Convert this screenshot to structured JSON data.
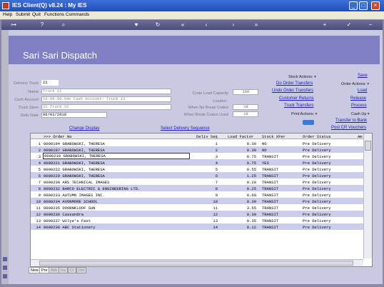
{
  "window": {
    "title": "IES Client(Q) v8.24 : My IES"
  },
  "menu": [
    "Help",
    "Submit",
    "Quit",
    "Functions",
    "Commands"
  ],
  "page": {
    "title": "Sari Sari Dispatch"
  },
  "form": {
    "delivery_truck": {
      "label": "Delivery Truck",
      "value": "22"
    },
    "name": {
      "label": "Name",
      "value": "Truck 22"
    },
    "cash_account": {
      "label": "Cash Account",
      "value": "18-08-00-04e Cash Account: Truck 22"
    },
    "truck_store": {
      "label": "Truck Store",
      "value": "22 Truck 22"
    },
    "deliv_date": {
      "label": "Deliv Date",
      "value": "06/02/2010"
    },
    "crate_load_capacity": {
      "label": "Crate Load Capacity",
      "value": "100"
    },
    "loaded": {
      "label": "Loaded -"
    },
    "when_no_break": {
      "label": "When No Break Crates",
      "value": "18"
    },
    "when_break": {
      "label": "When Break Crates Used",
      "value": "18"
    }
  },
  "links": {
    "change_display": "Change Display",
    "select_delivery_sequence": "Select Delivery Sequence",
    "save": "Save",
    "do_order_transfers": "Do Order Transfers",
    "undo_order_transfers": "Undo Order Transfers",
    "customer_returns": "Customer Returns",
    "truck_transfers": "Truck Transfers",
    "load": "Load",
    "release": "Release",
    "process": "Process",
    "transfer_to_bank": "Transfer to Bank",
    "post_cr_vouchers": "Post CR Vouchers"
  },
  "status": {
    "stock_actions": "Stock Actions:",
    "order_actions": "Order Actions:",
    "print_actions": "Print Actions:",
    "cash_up": "Cash Up"
  },
  "grid": {
    "headers": [
      ">>> Order No",
      "Deliv Seq",
      "Load Factor",
      "Stock XFer",
      "Order Status",
      "Am"
    ],
    "rows": [
      {
        "n": "1",
        "order": "0000194 GRABOWSKI, THERESA",
        "seq": "1",
        "lf": "0.30",
        "sx": "NO",
        "status": "Pre Delivery"
      },
      {
        "n": "2",
        "order": "0000197 GRABOWSKI, THERESA",
        "seq": "2",
        "lf": "0.30",
        "sx": "NO",
        "status": "Pre Delivery"
      },
      {
        "n": "3",
        "order": "0000210 GRABOWSKI, THERESA",
        "seq": "3",
        "lf": "0.75",
        "sx": "TRANSIT",
        "status": "Pre Delivery"
      },
      {
        "n": "4",
        "order": "0000221 GRABOWSKI, THERESA",
        "seq": "4",
        "lf": "0.75",
        "sx": "YES",
        "status": "Pre Delivery"
      },
      {
        "n": "5",
        "order": "0000222 GRABOWSKI, THERESA",
        "seq": "5",
        "lf": "0.55",
        "sx": "TRANSIT",
        "status": "Pre Delivery"
      },
      {
        "n": "6",
        "order": "0000229 GRABOWSKI, THERESA",
        "seq": "6",
        "lf": "1.25",
        "sx": "TRANSIT",
        "status": "Pre Delivery"
      },
      {
        "n": "7",
        "order": "0000230 ARS TECHNICAL IMAGES",
        "seq": "7",
        "lf": "0.20",
        "sx": "TRANSIT",
        "status": "Pre Delivery"
      },
      {
        "n": "8",
        "order": "0000232 BARCO ELECTRIC & ENGINEERING LTD.",
        "seq": "8",
        "lf": "0.25",
        "sx": "TRANSIT",
        "status": "Pre Delivery"
      },
      {
        "n": "9",
        "order": "0000233 AUTUMN IMAGES INC.",
        "seq": "9",
        "lf": "0.60",
        "sx": "TRANSIT",
        "status": "Pre Delivery"
      },
      {
        "n": "10",
        "order": "0000234 AVONMORE SCHOOL",
        "seq": "10",
        "lf": "0.30",
        "sx": "TRANSIT",
        "status": "Pre Delivery"
      },
      {
        "n": "11",
        "order": "0000235 DOORNKLOOF SUN",
        "seq": "11",
        "lf": "3.55",
        "sx": "TRANSIT",
        "status": "Pre Delivery"
      },
      {
        "n": "12",
        "order": "0000236 Cassandra",
        "seq": "12",
        "lf": "0.30",
        "sx": "TRANSIT",
        "status": "Pre Delivery"
      },
      {
        "n": "13",
        "order": "0000237 Wilye's Fast",
        "seq": "13",
        "lf": "0.35",
        "sx": "TRANSIT",
        "status": "Pre Delivery"
      },
      {
        "n": "14",
        "order": "0000238 ABC Stationery",
        "seq": "14",
        "lf": "0.12",
        "sx": "TRANSIT",
        "status": "Pre Delivery"
      }
    ]
  },
  "tabs": [
    "New",
    "Pre",
    "Adv",
    "Inv",
    "Cr",
    "Del"
  ]
}
